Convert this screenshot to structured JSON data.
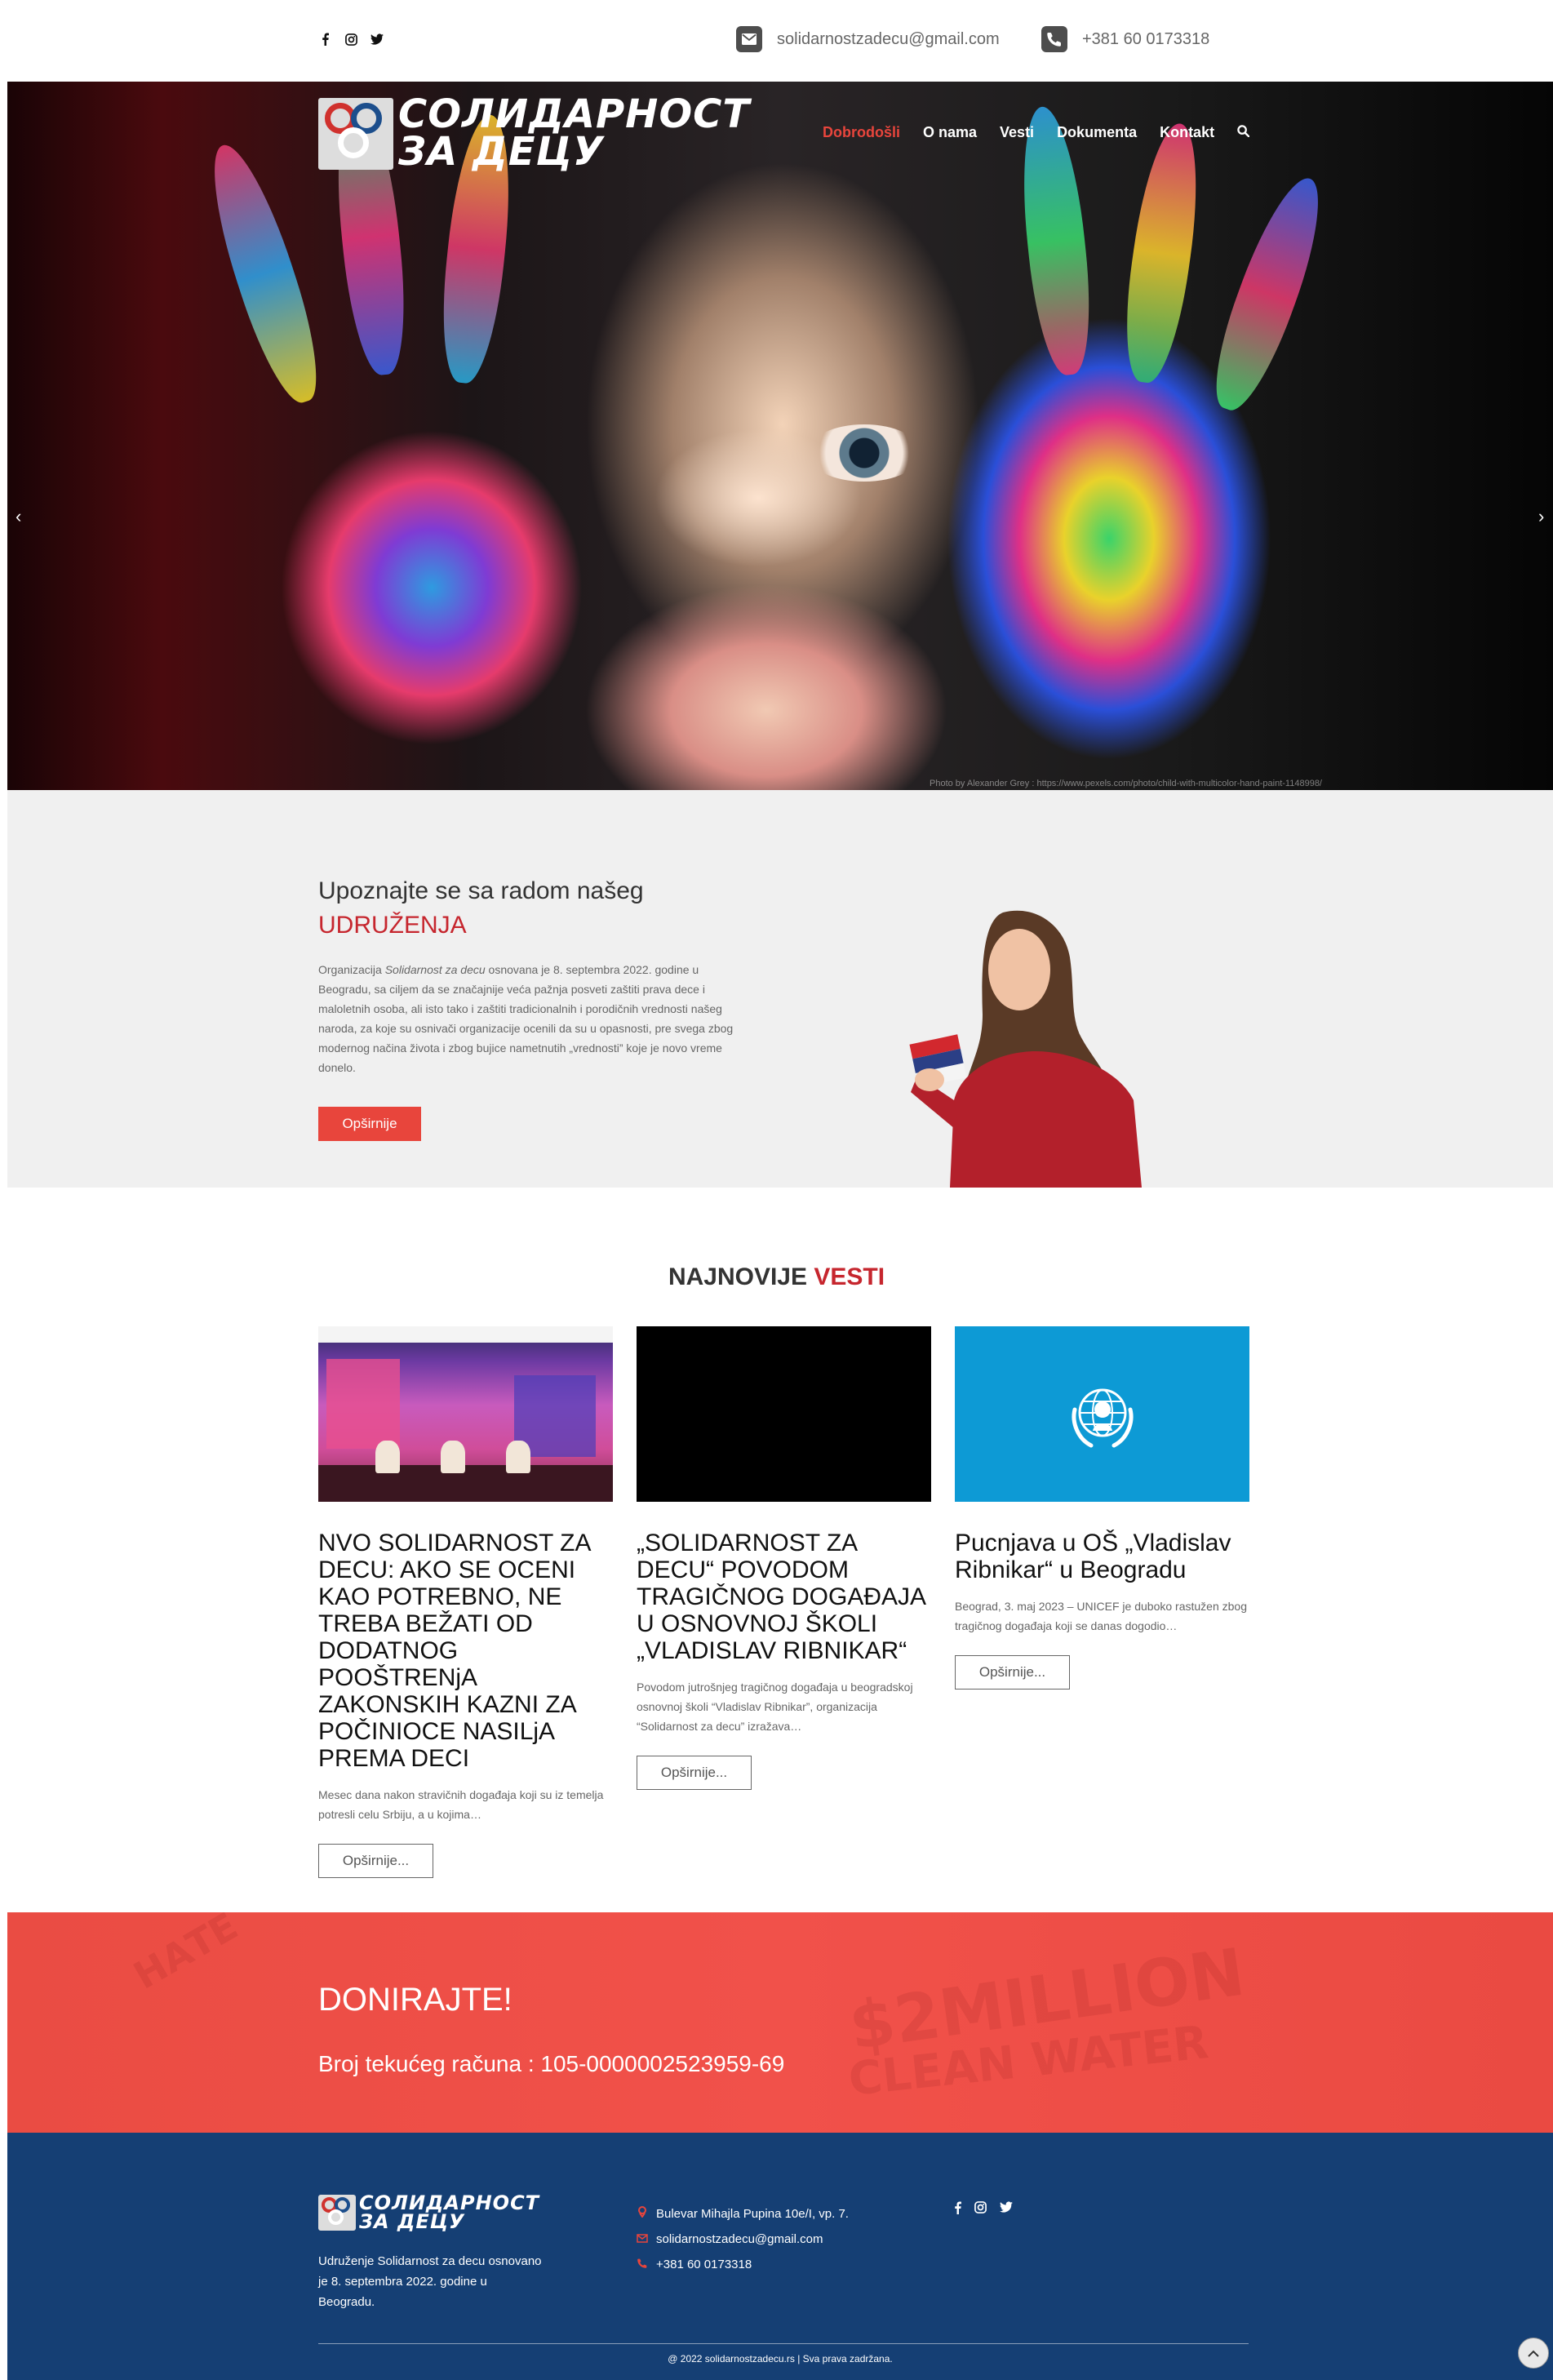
{
  "topbar": {
    "social": [
      "facebook-icon",
      "instagram-icon",
      "twitter-icon"
    ],
    "email": "solidarnostzadecu@gmail.com",
    "phone": "+381 60 0173318"
  },
  "header": {
    "logo_line1": "СОЛИДАРНОСТ",
    "logo_line2": "ЗА ДЕЦУ",
    "nav": [
      {
        "label": "Dobrodošli",
        "active": true
      },
      {
        "label": "O nama"
      },
      {
        "label": "Vesti"
      },
      {
        "label": "Dokumenta"
      },
      {
        "label": "Kontakt"
      }
    ]
  },
  "hero": {
    "credit": "Photo by Alexander Grey : https://www.pexels.com/photo/child-with-multicolor-hand-paint-1148998/"
  },
  "about": {
    "title": "Upoznajte se sa radom našeg",
    "title_red": "UDRUŽENJA",
    "text_pre": "Organizacija ",
    "text_em": "Solidarnost za decu",
    "text_post": " osnovana je 8. septembra 2022. godine u Beogradu, sa ciljem da se značajnije veća pažnja posveti zaštiti prava dece i maloletnih osoba, ali isto tako i zaštiti tradicionalnih i porodičnih vrednosti našeg naroda, za koje su osnivači organizacije ocenili da su u opasnosti, pre svega zbog modernog načina života i zbog bujice nametnutih „vrednosti” koje je novo vreme donelo.",
    "button": "Opširnije"
  },
  "news": {
    "title": "NAJNOVIJE",
    "title_red": "VESTI",
    "items": [
      {
        "title": "NVO SOLIDARNOST ZA DECU: AKO SE OCENI KAO POTREBNO, NE TREBA BEŽATI OD DODATNOG POOŠTRENjA ZAKONSKIH KAZNI ZA POČINIOCE NASILjA PREMA DECI",
        "excerpt": "Mesec dana nakon stravičnih događaja koji su iz temelja potresli celu Srbiju, a u kojima…",
        "button": "Opširnije..."
      },
      {
        "title": "„SOLIDARNOST ZA DECU“ POVODOM TRAGIČNOG DOGAĐAJA U OSNOVNOJ ŠKOLI „VLADISLAV RIBNIKAR“",
        "excerpt": "Povodom jutrošnjeg tragičnog događaja u beogradskoj osnovnoj školi “Vladislav Ribnikar”, organizacija “Solidarnost za decu” izražava…",
        "button": "Opširnije..."
      },
      {
        "title": "Pucnjava u OŠ „Vladislav Ribnikar“ u Beogradu",
        "excerpt": "Beograd, 3. maj 2023 – UNICEF je duboko rastužen zbog tragičnog događaja koji se danas dogodio…",
        "button": "Opširnije..."
      }
    ]
  },
  "donate": {
    "title": "DONIRAJTE!",
    "account": "Broj tekućeg računa : 105-0000002523959-69"
  },
  "footer": {
    "about": "Udruženje Solidarnost za decu osnovano je 8. septembra 2022. godine u Beogradu.",
    "address": "Bulevar Mihajla Pupina 10e/I, vp. 7.",
    "email": "solidarnostzadecu@gmail.com",
    "phone": "+381 60 0173318",
    "copyright": "@ 2022 solidarnostzadecu.rs | Sva prava zadržana."
  },
  "colors": {
    "accent_red": "#e8453c",
    "title_red": "#c6262e",
    "footer_blue": "#153f74",
    "unicef_blue": "#0d9ad5"
  }
}
